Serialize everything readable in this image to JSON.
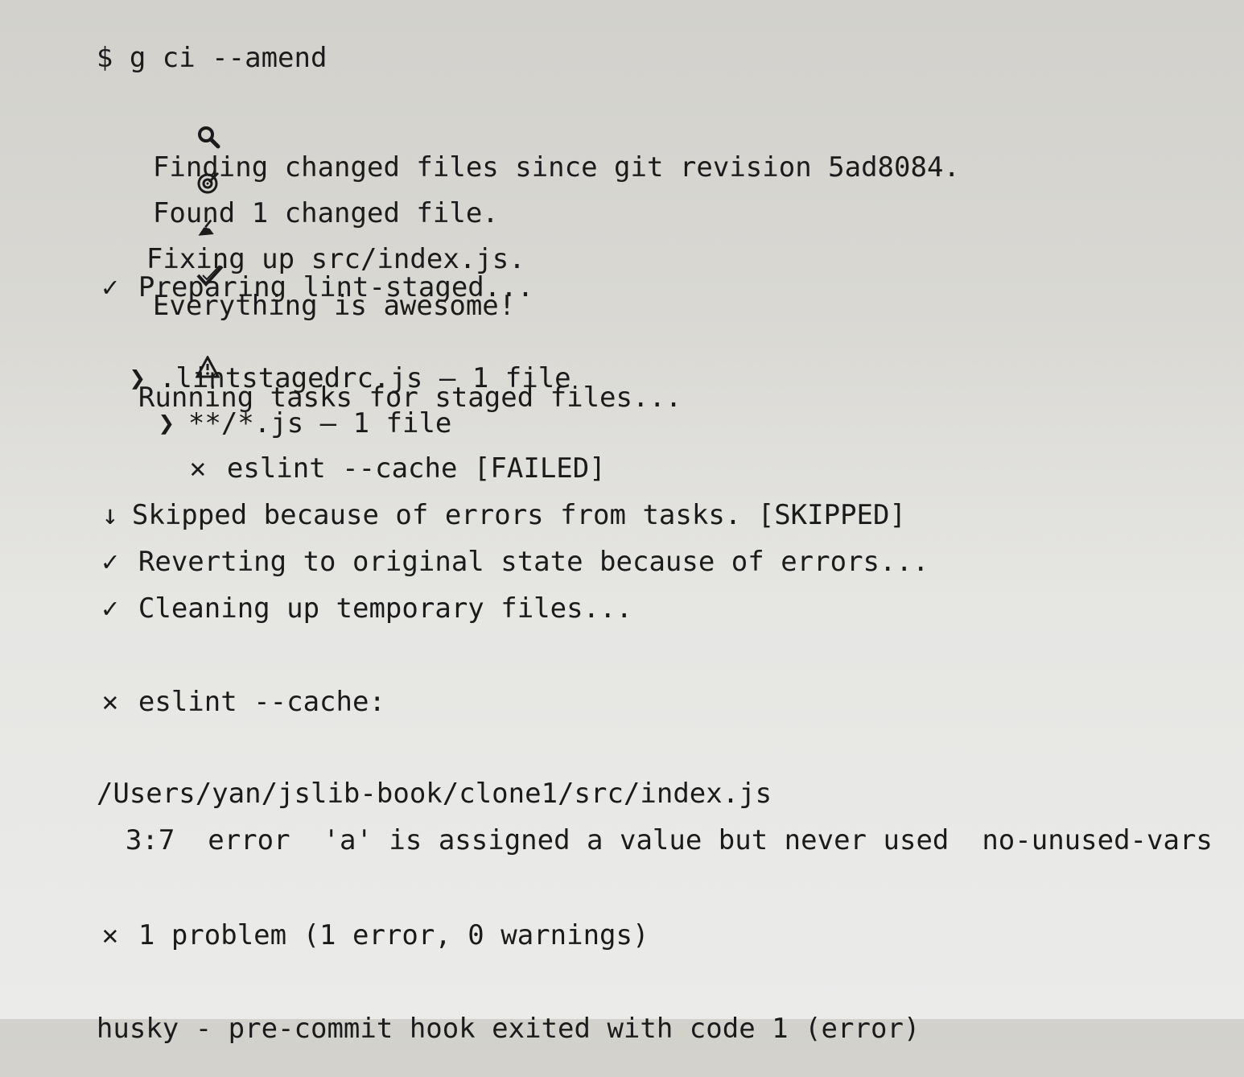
{
  "terminal": {
    "prompt": "$ g ci --amend",
    "lines": [
      {
        "icon": "search-icon",
        "text": "Finding changed files since git revision 5ad8084."
      },
      {
        "icon": "target-icon",
        "text": "Found 1 changed file."
      },
      {
        "icon": "hand-writing-icon",
        "text": "Fixing up src/index.js."
      },
      {
        "icon": "check-double-icon",
        "text": "Everything is awesome!"
      },
      {
        "icon": "check-icon",
        "text": "Preparing lint-staged..."
      },
      {
        "icon": "warning-icon",
        "text": "Running tasks for staged files..."
      },
      {
        "icon": "chevron-right-icon",
        "text": ".lintstagedrc.js — 1 file"
      },
      {
        "icon": "chevron-right-icon",
        "text": "**/*.js — 1 file"
      },
      {
        "icon": "cross-icon",
        "text": "eslint --cache [FAILED]"
      },
      {
        "icon": "arrow-down-icon",
        "text": "Skipped because of errors from tasks. [SKIPPED]"
      },
      {
        "icon": "check-icon",
        "text": "Reverting to original state because of errors..."
      },
      {
        "icon": "check-icon",
        "text": "Cleaning up temporary files..."
      },
      {
        "icon": "cross-icon",
        "text": "eslint --cache:"
      },
      {
        "icon": "",
        "text": "/Users/yan/jslib-book/clone1/src/index.js"
      },
      {
        "icon": "",
        "text": "3:7  error  'a' is assigned a value but never used  no-unused-vars"
      },
      {
        "icon": "cross-icon",
        "text": "1 problem (1 error, 0 warnings)"
      },
      {
        "icon": "",
        "text": "husky - pre-commit hook exited with code 1 (error)"
      }
    ]
  },
  "colors": {
    "text": "#1b1b1b",
    "background": "#dedddb"
  }
}
